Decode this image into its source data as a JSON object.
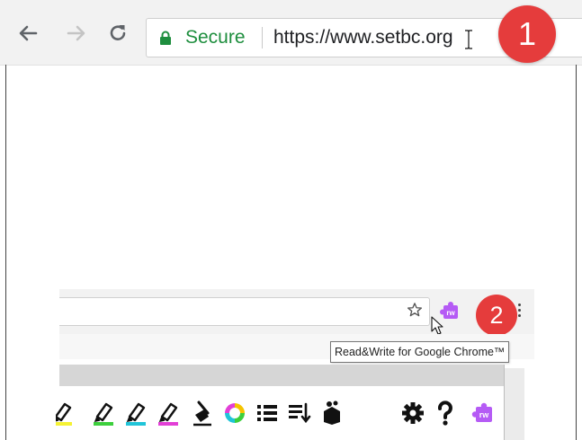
{
  "browser": {
    "security_label": "Secure",
    "url": "https://www.setbc.org",
    "step_one": "1",
    "step_two": "2",
    "extension_tooltip": "Read&Write for Google Chrome™",
    "icons": [
      "back-arrow-icon",
      "forward-arrow-icon",
      "reload-icon",
      "lock-icon",
      "text-cursor-icon",
      "star-icon",
      "rw-extension-icon",
      "mouse-pointer-icon",
      "more-menu-icon"
    ]
  },
  "readwrite_toolbar": {
    "icons": [
      "highlighter-yellow-icon",
      "highlighter-green-icon",
      "highlighter-blue-icon",
      "highlighter-pink-icon",
      "clear-highlights-icon",
      "collect-highlights-icon",
      "vocabulary-list-icon",
      "simplify-page-icon",
      "screen-masking-icon",
      "settings-icon",
      "help-icon",
      "rw-logo-icon"
    ],
    "colors": {
      "yellow": "#f5f233",
      "green": "#3ccf3c",
      "blue": "#20c4d8",
      "pink": "#e23fd6",
      "purple": "#b55bf5",
      "badge_red": "#e53c3c",
      "secure_green": "#1e8e3e"
    }
  }
}
